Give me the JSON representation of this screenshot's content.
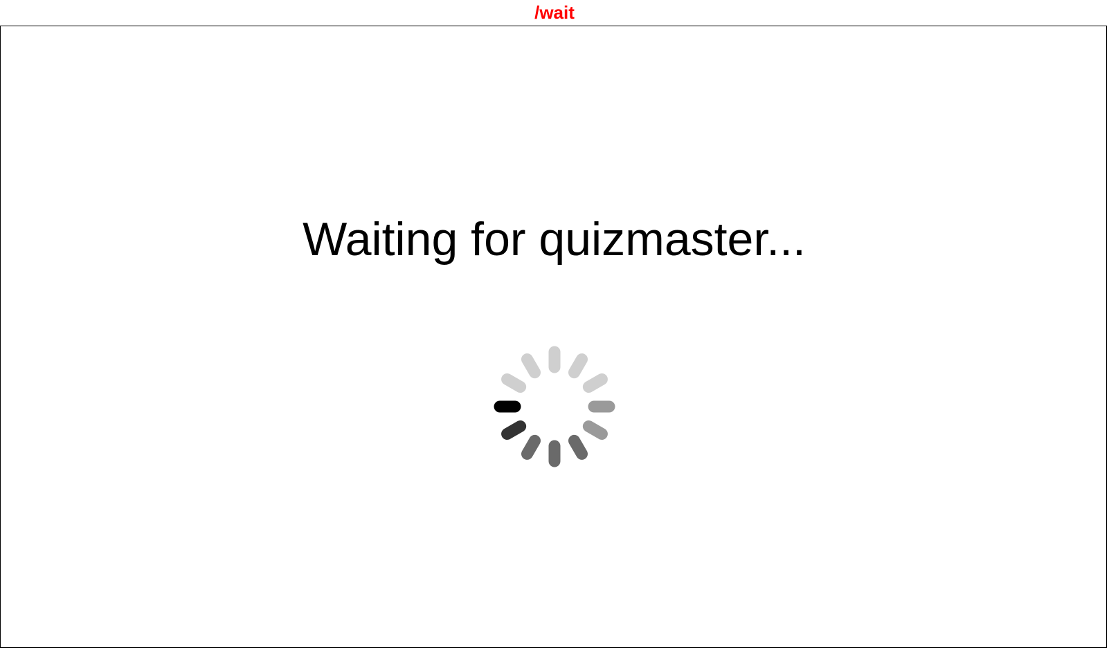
{
  "route": {
    "label": "/wait",
    "color": "#ff0000"
  },
  "main": {
    "status_text": "Waiting for quizmaster..."
  },
  "spinner": {
    "icon": "loading-spinner-icon",
    "spoke_count": 12,
    "spoke_colors": [
      "#cfcfcf",
      "#cfcfcf",
      "#cfcfcf",
      "#9a9a9a",
      "#9a9a9a",
      "#6a6a6a",
      "#6a6a6a",
      "#6a6a6a",
      "#333333",
      "#000000",
      "#cfcfcf",
      "#cfcfcf"
    ]
  }
}
